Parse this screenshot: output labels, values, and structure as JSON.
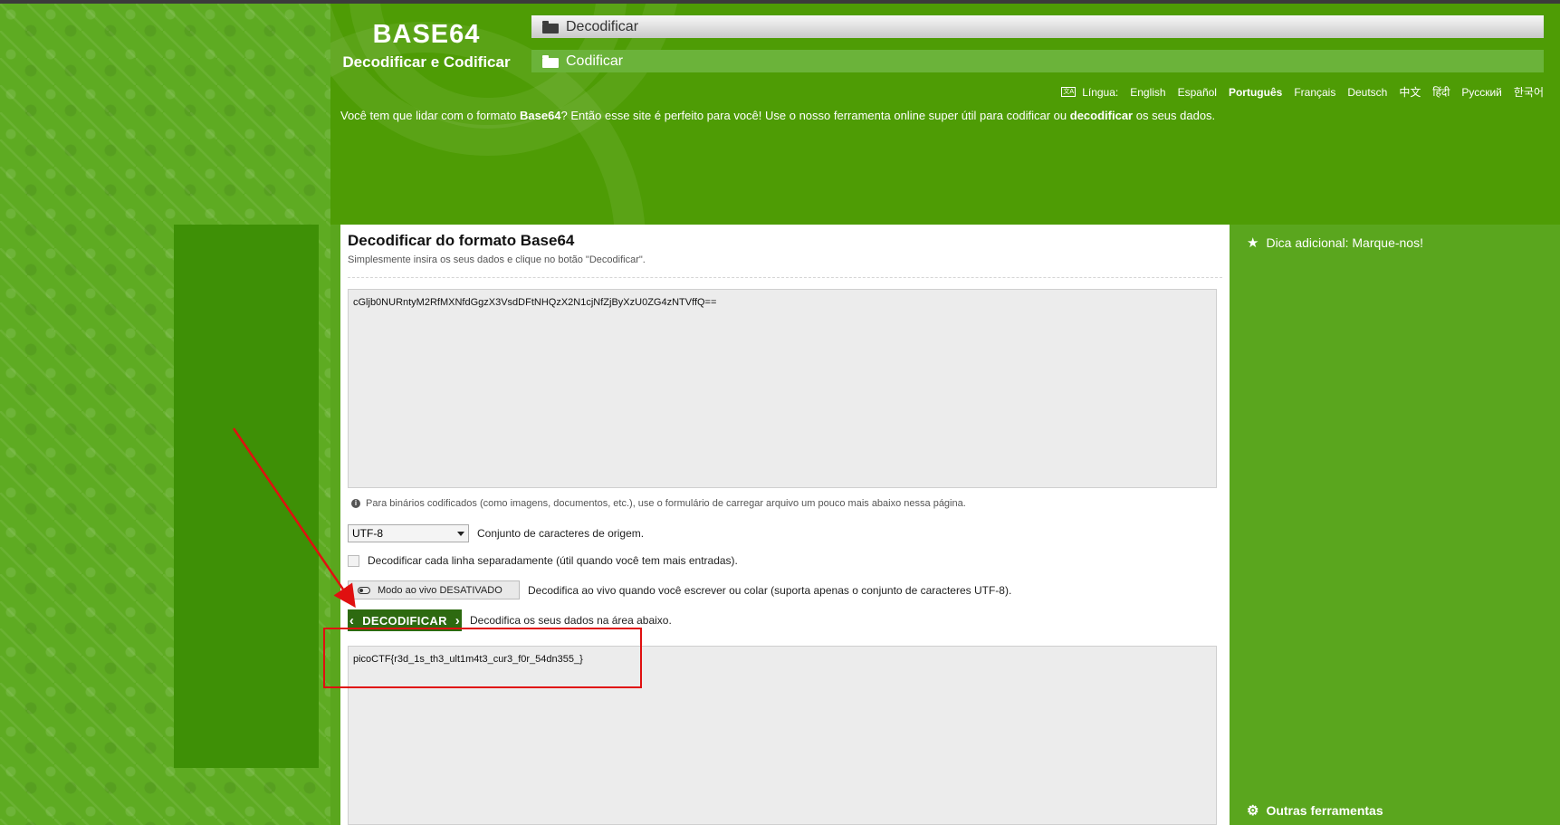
{
  "logo": {
    "main": "BASE64",
    "sub": "Decodificar e Codificar"
  },
  "nav": {
    "decode_label": "Decodificar",
    "encode_label": "Codificar"
  },
  "languages": {
    "label": "Língua:",
    "items": [
      "English",
      "Español",
      "Português",
      "Français",
      "Deutsch",
      "中文",
      "हिंदी",
      "Русский",
      "한국어"
    ],
    "active": "Português"
  },
  "intro": {
    "part1": "Você tem que lidar com o formato ",
    "bold1": "Base64",
    "part2": "? Então esse site é perfeito para você! Use o nosso ferramenta online super útil para codificar ou ",
    "bold2": "decodificar",
    "part3": " os seus dados."
  },
  "panel": {
    "title": "Decodificar do formato Base64",
    "subtitle": "Simplesmente insira os seus dados e clique no botão \"Decodificar\".",
    "input_value": "cGljb0NURntyM2RfMXNfdGgzX3VsdDFtNHQzX2N1cjNfZjByXzU0ZG4zNTVffQ==",
    "hint": "Para binários codificados (como imagens, documentos, etc.), use o formulário de carregar arquivo um pouco mais abaixo nessa página.",
    "charset_value": "UTF-8",
    "charset_label": "Conjunto de caracteres de origem.",
    "each_line_label": "Decodificar cada linha separadamente (útil quando você tem mais entradas).",
    "live_mode_label": "Modo ao vivo DESATIVADO",
    "live_mode_desc": "Decodifica ao vivo quando você escrever ou colar (suporta apenas o conjunto de caracteres UTF-8).",
    "decode_button": "DECODIFICAR",
    "decode_desc": "Decodifica os seus dados na área abaixo.",
    "output_value": "picoCTF{r3d_1s_th3_ult1m4t3_cur3_f0r_54dn355_}"
  },
  "sidebar": {
    "tip": "Dica adicional: Marque-nos!",
    "tools": "Outras ferramentas"
  },
  "colors": {
    "header_green": "#4e9c05",
    "button_dark_green": "#2d6a10",
    "annotation_red": "#e01010"
  }
}
